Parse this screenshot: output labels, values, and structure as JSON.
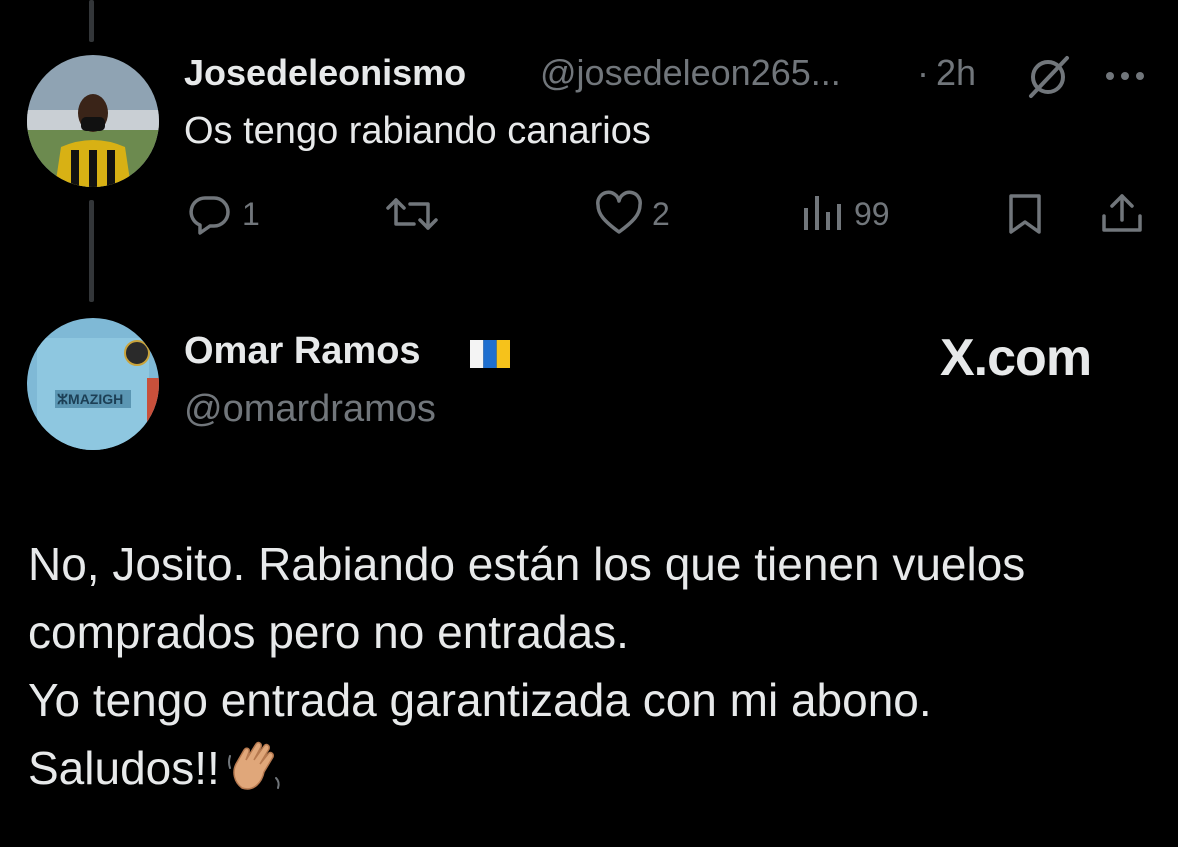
{
  "tweet1": {
    "display_name": "Josedeleonismo",
    "handle": "@josedeleon265...",
    "separator": "·",
    "time": "2h",
    "text": "Os tengo rabiando canarios",
    "actions": {
      "reply_count": "1",
      "retweet_count": "",
      "like_count": "2",
      "view_count": "99"
    }
  },
  "tweet2": {
    "display_name": "Omar Ramos",
    "handle": "@omardramos",
    "watermark": "X.com",
    "body_lines": [
      "No, Josito. Rabiando están los que tienen vuelos",
      "comprados pero no entradas.",
      "Yo tengo entrada garantizada con mi abono.",
      "Saludos!!"
    ]
  },
  "icons": [
    "grok-icon",
    "more-icon",
    "reply-icon",
    "retweet-icon",
    "like-icon",
    "views-icon",
    "bookmark-icon",
    "share-icon",
    "canary-flag-icon",
    "waving-hand-emoji"
  ],
  "colors": {
    "background": "#000000",
    "text": "#e7e9ea",
    "secondary": "#71767b",
    "thread_line": "#333639"
  }
}
